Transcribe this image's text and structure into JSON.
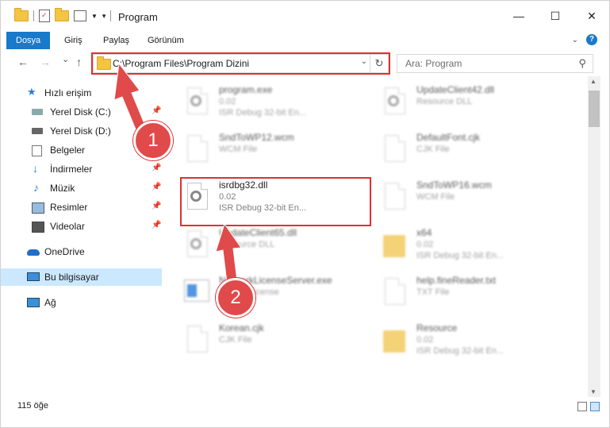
{
  "window": {
    "title": "Program",
    "min_glyph": "—",
    "max_glyph": "☐",
    "close_glyph": "✕"
  },
  "ribbon": {
    "tabs": [
      "Dosya",
      "Giriş",
      "Paylaş",
      "Görünüm"
    ],
    "help_glyph": "?"
  },
  "address": {
    "path": "C:\\Program Files\\Program Dizini",
    "refresh_glyph": "↻"
  },
  "search": {
    "placeholder": "Ara: Program"
  },
  "nav": {
    "back": "←",
    "forward": "→",
    "recent": "⌄",
    "up": "↑"
  },
  "sidebar": {
    "items": [
      {
        "label": "Hızlı erişim",
        "icon": "star-icon",
        "pinned": false
      },
      {
        "label": "Yerel Disk (C:)",
        "icon": "drive-icon",
        "pinned": true
      },
      {
        "label": "Yerel Disk (D:)",
        "icon": "drive-icon",
        "pinned": false
      },
      {
        "label": "Belgeler",
        "icon": "document-icon",
        "pinned": true
      },
      {
        "label": "İndirmeler",
        "icon": "download-icon",
        "pinned": true
      },
      {
        "label": "Müzik",
        "icon": "music-icon",
        "pinned": true
      },
      {
        "label": "Resimler",
        "icon": "pictures-icon",
        "pinned": true
      },
      {
        "label": "Videolar",
        "icon": "video-icon",
        "pinned": true
      },
      {
        "label": "OneDrive",
        "icon": "cloud-icon",
        "pinned": false
      },
      {
        "label": "Bu bilgisayar",
        "icon": "computer-icon",
        "pinned": false
      },
      {
        "label": "Ağ",
        "icon": "network-icon",
        "pinned": false
      }
    ]
  },
  "files": {
    "left": [
      {
        "name": "program.exe",
        "l2": "0.02",
        "l3": "ISR Debug 32-bit En..."
      },
      {
        "name": "SndToWP12.wcm",
        "l2": "WCM File",
        "l3": ""
      },
      {
        "name": "isrdbg32.dll",
        "l2": "0.02",
        "l3": "ISR Debug 32-bit En..."
      },
      {
        "name": "UpdateClient65.dll",
        "l2": "Resource DLL",
        "l3": ""
      },
      {
        "name": "NetworkLicenseServer.exe",
        "l2": "network license",
        "l3": ""
      },
      {
        "name": "Korean.cjk",
        "l2": "CJK File",
        "l3": ""
      }
    ],
    "right": [
      {
        "name": "UpdateClient42.dll",
        "l2": "Resource DLL",
        "l3": ""
      },
      {
        "name": "DefaultFont.cjk",
        "l2": "CJK File",
        "l3": ""
      },
      {
        "name": "SndToWP16.wcm",
        "l2": "WCM File",
        "l3": ""
      },
      {
        "name": "x64",
        "l2": "0.02",
        "l3": "ISR Debug 32-bit En..."
      },
      {
        "name": "help.fineReader.txt",
        "l2": "TXT File",
        "l3": ""
      },
      {
        "name": "Resource",
        "l2": "0.02",
        "l3": "ISR Debug 32-bit En..."
      }
    ]
  },
  "status": {
    "count": "115 öğe"
  },
  "annotations": {
    "step1": "1",
    "step2": "2",
    "color": "#e03030"
  }
}
